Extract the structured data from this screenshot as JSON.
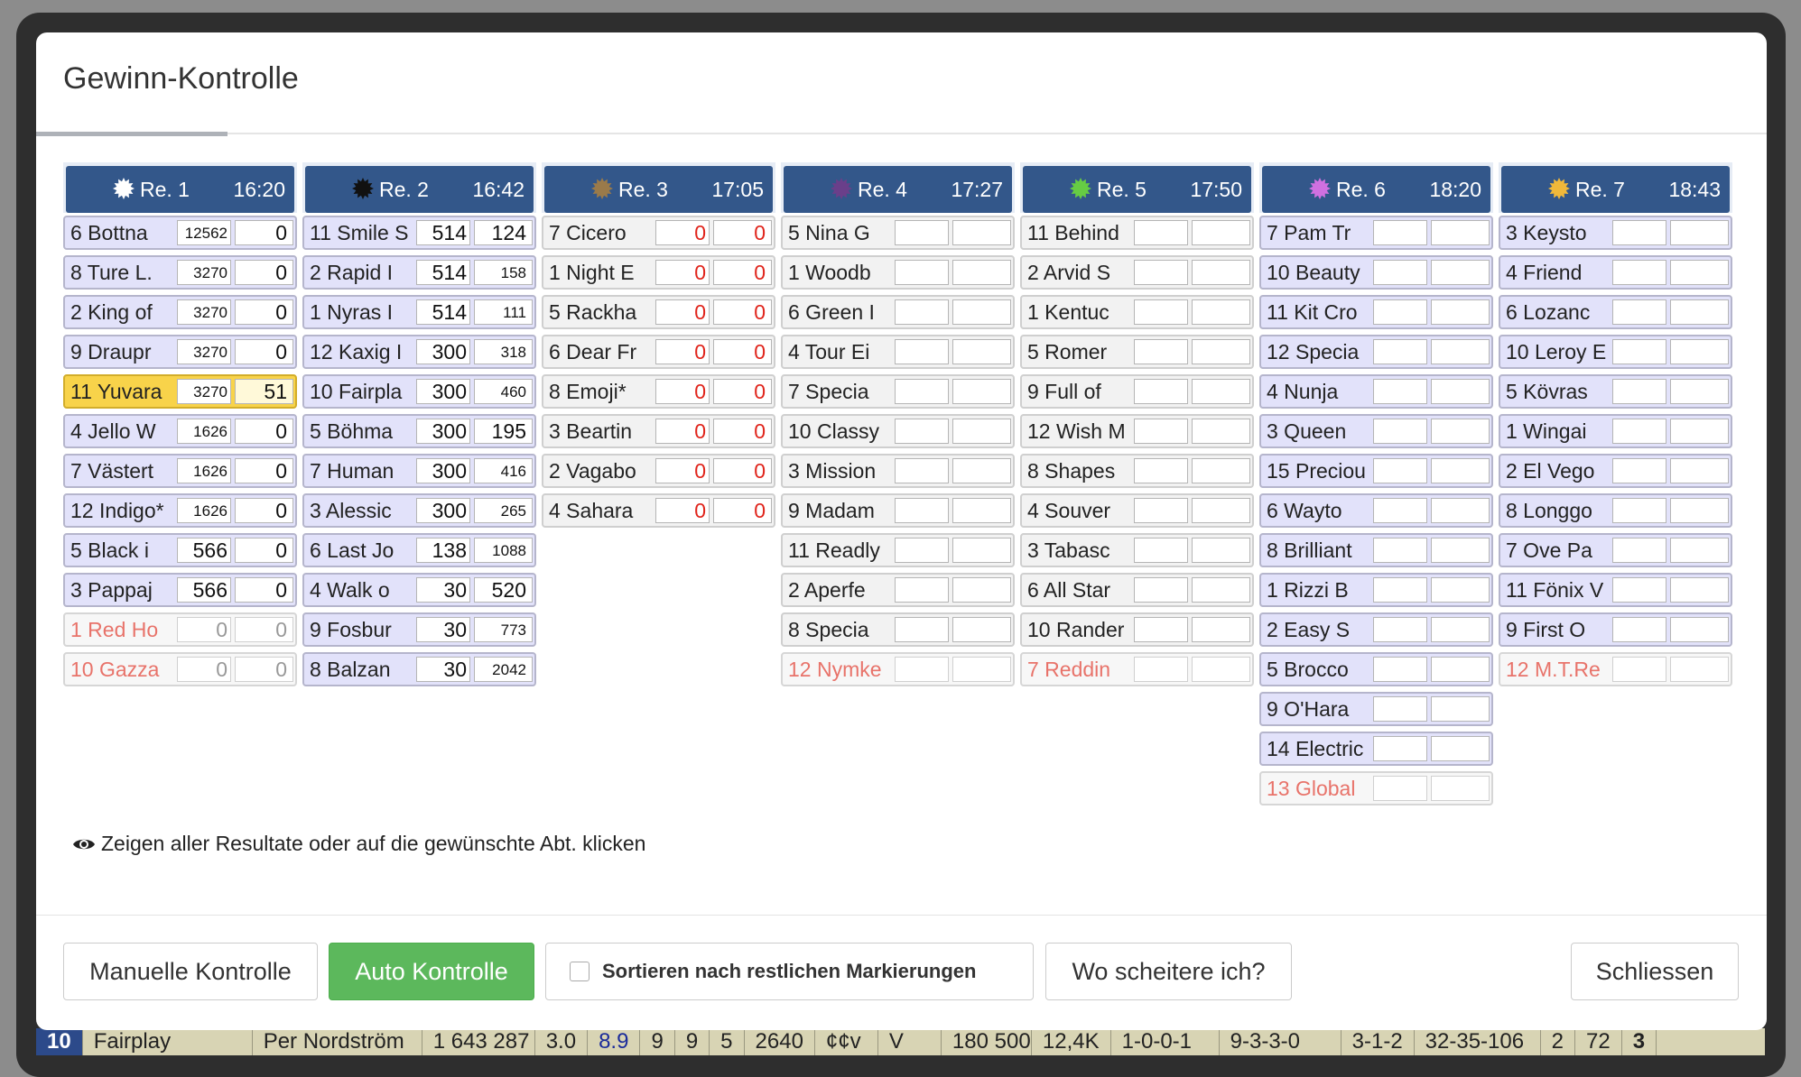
{
  "background_row": {
    "cells": [
      "10",
      "Fairplay",
      "Per Nordström",
      "1 643 287",
      "3.0",
      "8.9",
      "9",
      "9",
      "5",
      "2640",
      "¢¢v",
      "V",
      "180 500",
      "12,4K",
      "1-0-0-1",
      "9-3-3-0",
      "3-1-2",
      "32-35-106",
      "2",
      "72",
      "3"
    ]
  },
  "modal": {
    "title": "Gewinn-Kontrolle",
    "hint_icon": "eye-icon",
    "hint": "Zeigen aller Resultate oder auf die gewünschte Abt. klicken"
  },
  "colors": {
    "header_bg": "#33578a",
    "selected_row": "#f8d34a",
    "excluded_text": "#e8736a",
    "green_button": "#5cb85c",
    "red_value": "#e0241b"
  },
  "races": [
    {
      "name": "Re. 1",
      "time": "16:20",
      "symbol_color": "#ffffff",
      "rows": [
        {
          "label": "6 Bottna",
          "v1": "12562",
          "v2": "0",
          "state": "normal"
        },
        {
          "label": "8 Ture L.",
          "v1": "3270",
          "v2": "0",
          "state": "normal"
        },
        {
          "label": "2 King of",
          "v1": "3270",
          "v2": "0",
          "state": "normal"
        },
        {
          "label": "9 Draupr",
          "v1": "3270",
          "v2": "0",
          "state": "normal"
        },
        {
          "label": "11 Yuvara",
          "v1": "3270",
          "v2": "51",
          "state": "selected"
        },
        {
          "label": "4 Jello W",
          "v1": "1626",
          "v2": "0",
          "state": "normal"
        },
        {
          "label": "7 Västert",
          "v1": "1626",
          "v2": "0",
          "state": "normal"
        },
        {
          "label": "12 Indigo*",
          "v1": "1626",
          "v2": "0",
          "state": "normal"
        },
        {
          "label": "5 Black i",
          "v1": "566",
          "v2": "0",
          "state": "normal"
        },
        {
          "label": "3 Pappaj",
          "v1": "566",
          "v2": "0",
          "state": "normal"
        },
        {
          "label": "1 Red Ho",
          "v1": "0",
          "v2": "0",
          "state": "excluded"
        },
        {
          "label": "10 Gazza",
          "v1": "0",
          "v2": "0",
          "state": "excluded"
        }
      ]
    },
    {
      "name": "Re. 2",
      "time": "16:42",
      "symbol_color": "#111111",
      "rows": [
        {
          "label": "11 Smile S",
          "v1": "514",
          "v2": "124",
          "state": "normal"
        },
        {
          "label": "2 Rapid I",
          "v1": "514",
          "v2": "158",
          "state": "normal"
        },
        {
          "label": "1 Nyras I",
          "v1": "514",
          "v2": "111",
          "state": "normal"
        },
        {
          "label": "12 Kaxig I",
          "v1": "300",
          "v2": "318",
          "state": "normal"
        },
        {
          "label": "10 Fairpla",
          "v1": "300",
          "v2": "460",
          "state": "normal"
        },
        {
          "label": "5 Böhma",
          "v1": "300",
          "v2": "195",
          "state": "normal"
        },
        {
          "label": "7 Human",
          "v1": "300",
          "v2": "416",
          "state": "normal"
        },
        {
          "label": "3 Alessic",
          "v1": "300",
          "v2": "265",
          "state": "normal"
        },
        {
          "label": "6 Last Jo",
          "v1": "138",
          "v2": "1088",
          "state": "normal"
        },
        {
          "label": "4 Walk o",
          "v1": "30",
          "v2": "520",
          "state": "normal"
        },
        {
          "label": "9 Fosbur",
          "v1": "30",
          "v2": "773",
          "state": "normal"
        },
        {
          "label": "8 Balzan",
          "v1": "30",
          "v2": "2042",
          "state": "normal"
        }
      ]
    },
    {
      "name": "Re. 3",
      "time": "17:05",
      "symbol_color": "#9a7a4a",
      "rows": [
        {
          "label": "7 Cicero",
          "v1": "0",
          "v2": "0",
          "state": "gray_red"
        },
        {
          "label": "1 Night E",
          "v1": "0",
          "v2": "0",
          "state": "gray_red"
        },
        {
          "label": "5 Rackha",
          "v1": "0",
          "v2": "0",
          "state": "gray_red"
        },
        {
          "label": "6 Dear Fr",
          "v1": "0",
          "v2": "0",
          "state": "gray_red"
        },
        {
          "label": "8 Emoji*",
          "v1": "0",
          "v2": "0",
          "state": "gray_red"
        },
        {
          "label": "3 Beartin",
          "v1": "0",
          "v2": "0",
          "state": "gray_red"
        },
        {
          "label": "2 Vagabo",
          "v1": "0",
          "v2": "0",
          "state": "gray_red"
        },
        {
          "label": "4 Sahara",
          "v1": "0",
          "v2": "0",
          "state": "gray_red"
        }
      ]
    },
    {
      "name": "Re. 4",
      "time": "17:27",
      "symbol_color": "#6a3f8a",
      "rows": [
        {
          "label": "5 Nina G",
          "v1": "",
          "v2": "",
          "state": "gray"
        },
        {
          "label": "1 Woodb",
          "v1": "",
          "v2": "",
          "state": "gray"
        },
        {
          "label": "6 Green I",
          "v1": "",
          "v2": "",
          "state": "gray"
        },
        {
          "label": "4 Tour Ei",
          "v1": "",
          "v2": "",
          "state": "gray"
        },
        {
          "label": "7 Specia",
          "v1": "",
          "v2": "",
          "state": "gray"
        },
        {
          "label": "10 Classy",
          "v1": "",
          "v2": "",
          "state": "gray"
        },
        {
          "label": "3 Mission",
          "v1": "",
          "v2": "",
          "state": "gray"
        },
        {
          "label": "9 Madam",
          "v1": "",
          "v2": "",
          "state": "gray"
        },
        {
          "label": "11 Readly",
          "v1": "",
          "v2": "",
          "state": "gray"
        },
        {
          "label": "2 Aperfe",
          "v1": "",
          "v2": "",
          "state": "gray"
        },
        {
          "label": "8 Specia",
          "v1": "",
          "v2": "",
          "state": "gray"
        },
        {
          "label": "12 Nymke",
          "v1": "",
          "v2": "",
          "state": "excluded"
        }
      ]
    },
    {
      "name": "Re. 5",
      "time": "17:50",
      "symbol_color": "#66cc44",
      "rows": [
        {
          "label": "11 Behind",
          "v1": "",
          "v2": "",
          "state": "gray"
        },
        {
          "label": "2 Arvid S",
          "v1": "",
          "v2": "",
          "state": "gray"
        },
        {
          "label": "1 Kentuc",
          "v1": "",
          "v2": "",
          "state": "gray"
        },
        {
          "label": "5 Romer",
          "v1": "",
          "v2": "",
          "state": "gray"
        },
        {
          "label": "9 Full of",
          "v1": "",
          "v2": "",
          "state": "gray"
        },
        {
          "label": "12 Wish M",
          "v1": "",
          "v2": "",
          "state": "gray"
        },
        {
          "label": "8 Shapes",
          "v1": "",
          "v2": "",
          "state": "gray"
        },
        {
          "label": "4 Souver",
          "v1": "",
          "v2": "",
          "state": "gray"
        },
        {
          "label": "3 Tabasc",
          "v1": "",
          "v2": "",
          "state": "gray"
        },
        {
          "label": "6 All Star",
          "v1": "",
          "v2": "",
          "state": "gray"
        },
        {
          "label": "10 Rander",
          "v1": "",
          "v2": "",
          "state": "gray"
        },
        {
          "label": "7 Reddin",
          "v1": "",
          "v2": "",
          "state": "excluded"
        }
      ]
    },
    {
      "name": "Re. 6",
      "time": "18:20",
      "symbol_color": "#d070e0",
      "rows": [
        {
          "label": "7 Pam Tr",
          "v1": "",
          "v2": "",
          "state": "normal"
        },
        {
          "label": "10 Beauty",
          "v1": "",
          "v2": "",
          "state": "normal"
        },
        {
          "label": "11 Kit Cro",
          "v1": "",
          "v2": "",
          "state": "normal"
        },
        {
          "label": "12 Specia",
          "v1": "",
          "v2": "",
          "state": "normal"
        },
        {
          "label": "4 Nunja",
          "v1": "",
          "v2": "",
          "state": "normal"
        },
        {
          "label": "3 Queen",
          "v1": "",
          "v2": "",
          "state": "normal"
        },
        {
          "label": "15 Preciou",
          "v1": "",
          "v2": "",
          "state": "normal"
        },
        {
          "label": "6 Wayto",
          "v1": "",
          "v2": "",
          "state": "normal"
        },
        {
          "label": "8 Brilliant",
          "v1": "",
          "v2": "",
          "state": "normal"
        },
        {
          "label": "1 Rizzi B",
          "v1": "",
          "v2": "",
          "state": "normal"
        },
        {
          "label": "2 Easy S",
          "v1": "",
          "v2": "",
          "state": "normal"
        },
        {
          "label": "5 Brocco",
          "v1": "",
          "v2": "",
          "state": "normal"
        },
        {
          "label": "9 O'Hara",
          "v1": "",
          "v2": "",
          "state": "normal"
        },
        {
          "label": "14 Electric",
          "v1": "",
          "v2": "",
          "state": "normal"
        },
        {
          "label": "13 Global",
          "v1": "",
          "v2": "",
          "state": "excluded"
        }
      ]
    },
    {
      "name": "Re. 7",
      "time": "18:43",
      "symbol_color": "#f0b83a",
      "rows": [
        {
          "label": "3 Keysto",
          "v1": "",
          "v2": "",
          "state": "normal"
        },
        {
          "label": "4 Friend",
          "v1": "",
          "v2": "",
          "state": "normal"
        },
        {
          "label": "6 Lozanc",
          "v1": "",
          "v2": "",
          "state": "normal"
        },
        {
          "label": "10 Leroy E",
          "v1": "",
          "v2": "",
          "state": "normal"
        },
        {
          "label": "5 Kövras",
          "v1": "",
          "v2": "",
          "state": "normal"
        },
        {
          "label": "1 Wingai",
          "v1": "",
          "v2": "",
          "state": "normal"
        },
        {
          "label": "2 El Vego",
          "v1": "",
          "v2": "",
          "state": "normal"
        },
        {
          "label": "8 Longgo",
          "v1": "",
          "v2": "",
          "state": "normal"
        },
        {
          "label": "7 Ove Pa",
          "v1": "",
          "v2": "",
          "state": "normal"
        },
        {
          "label": "11 Fönix V",
          "v1": "",
          "v2": "",
          "state": "normal"
        },
        {
          "label": "9 First O",
          "v1": "",
          "v2": "",
          "state": "normal"
        },
        {
          "label": "12 M.T.Re",
          "v1": "",
          "v2": "",
          "state": "excluded"
        }
      ]
    }
  ],
  "footer": {
    "manual_label": "Manuelle Kontrolle",
    "auto_label": "Auto Kontrolle",
    "sort_checkbox_label": "Sortieren nach restlichen Markierungen",
    "sort_checked": false,
    "fail_label": "Wo scheitere ich?",
    "close_label": "Schliessen"
  }
}
